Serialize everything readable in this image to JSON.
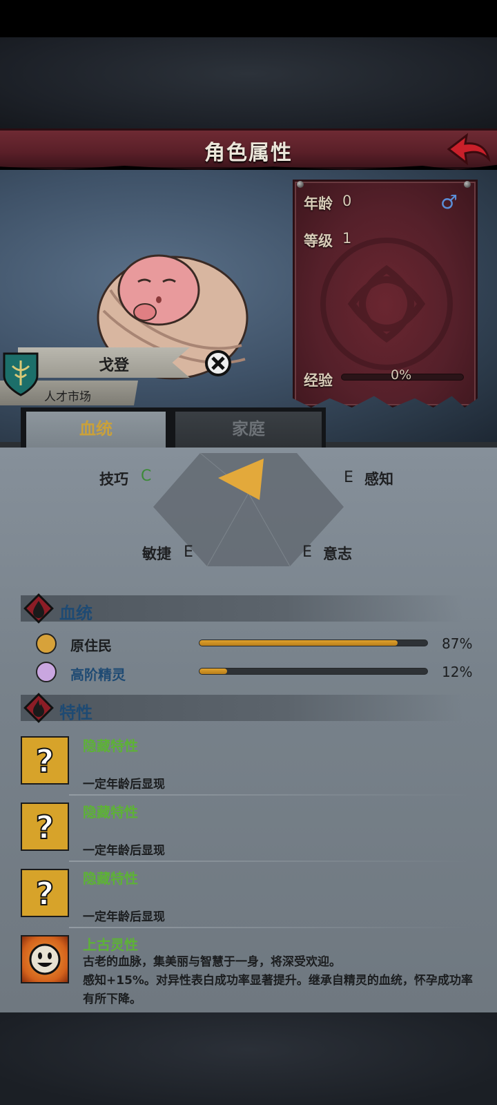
{
  "header": {
    "title": "角色属性"
  },
  "character": {
    "name": "戈登",
    "origin": "人才市场",
    "gender_symbol": "♂"
  },
  "stats": {
    "age_label": "年龄",
    "age_value": "0",
    "level_label": "等级",
    "level_value": "1",
    "exp_label": "经验",
    "exp_value": "0%",
    "exp_fraction": 0
  },
  "tabs": [
    {
      "label": "血统",
      "active": true
    },
    {
      "label": "家庭",
      "active": false
    }
  ],
  "radar": {
    "skill_label": "技巧",
    "skill_grade": "C",
    "perception_label": "感知",
    "perception_grade": "E",
    "agility_label": "敏捷",
    "agility_grade": "E",
    "will_label": "意志",
    "will_grade": "E"
  },
  "bloodline_section": {
    "title": "血统"
  },
  "bloodlines": [
    {
      "name": "原住民",
      "percent": "87%",
      "fraction": 0.87,
      "color": "#1b1d1f",
      "icon": "leaf-icon"
    },
    {
      "name": "高阶精灵",
      "percent": "12%",
      "fraction": 0.12,
      "color": "#1e4a73",
      "icon": "elf-eye-icon"
    }
  ],
  "traits_section": {
    "title": "特性"
  },
  "traits": [
    {
      "name": "隐藏特性",
      "desc": "一定年龄后显现",
      "icon": "question-icon"
    },
    {
      "name": "隐藏特性",
      "desc": "一定年龄后显现",
      "icon": "question-icon"
    },
    {
      "name": "隐藏特性",
      "desc": "一定年龄后显现",
      "icon": "question-icon"
    },
    {
      "name": "上古灵性",
      "desc": "古老的血脉，集美丽与智慧于一身，将深受欢迎。\n感知+15%。对异性表白成功率显著提升。继承自精灵的血统，怀孕成功率有所下降。",
      "icon": "smiley-sun-icon"
    }
  ],
  "colors": {
    "header": "#5a1f28",
    "accent_gold": "#e0a22c",
    "trait_green": "#5db236",
    "title_blue": "#1e4a73"
  }
}
